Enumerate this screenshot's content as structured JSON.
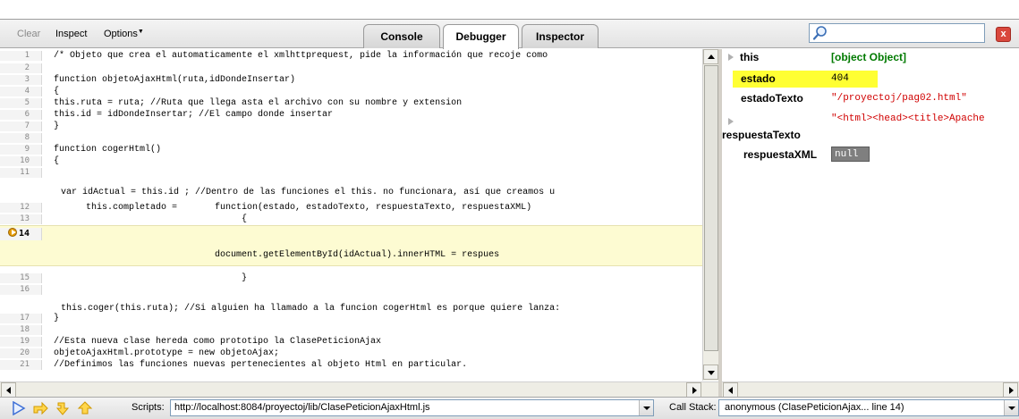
{
  "toolbar": {
    "clear_label": "Clear",
    "inspect_label": "Inspect",
    "options_label": "Options",
    "tabs": [
      {
        "label": "Console"
      },
      {
        "label": "Debugger"
      },
      {
        "label": "Inspector"
      }
    ],
    "search_placeholder": "",
    "close_label": "x"
  },
  "code": {
    "lines": [
      {
        "num": "1",
        "text": "/* Objeto que crea el automaticamente el xmlhttprequest, pide la información que recoje como "
      },
      {
        "num": "2",
        "text": ""
      },
      {
        "num": "3",
        "text": "function objetoAjaxHtml(ruta,idDondeInsertar)"
      },
      {
        "num": "4",
        "text": "{"
      },
      {
        "num": "5",
        "text": "this.ruta = ruta; //Ruta que llega asta el archivo con su nombre y extension"
      },
      {
        "num": "6",
        "text": "this.id = idDondeInsertar; //El campo donde insertar"
      },
      {
        "num": "7",
        "text": "}"
      },
      {
        "num": "8",
        "text": ""
      },
      {
        "num": "9",
        "text": "function cogerHtml()"
      },
      {
        "num": "10",
        "text": "{"
      },
      {
        "num": "11",
        "text": ""
      },
      {
        "num": "",
        "text": " var idActual = this.id ; //Dentro de las funciones el this. no funcionara, así que creamos u"
      },
      {
        "num": "12",
        "text": "      this.completado =       function(estado, estadoTexto, respuestaTexto, respuestaXML)"
      },
      {
        "num": "13",
        "text": "                                   {"
      },
      {
        "num": "14",
        "text": ""
      },
      {
        "num": "",
        "text": "                              document.getElementById(idActual).innerHTML = respues"
      },
      {
        "num": "15",
        "text": "                                   }"
      },
      {
        "num": "16",
        "text": ""
      },
      {
        "num": "",
        "text": " this.coger(this.ruta); //Si alguien ha llamado a la funcion cogerHtml es porque quiere lanza:"
      },
      {
        "num": "17",
        "text": "}"
      },
      {
        "num": "18",
        "text": ""
      },
      {
        "num": "19",
        "text": "//Esta nueva clase hereda como prototipo la ClasePeticionAjax"
      },
      {
        "num": "20",
        "text": "objetoAjaxHtml.prototype = new objetoAjax;"
      },
      {
        "num": "21",
        "text": "//Definimos las funciones nuevas pertenecientes al objeto Html en particular."
      }
    ]
  },
  "watch": {
    "this_name": "this",
    "this_value": "[object Object]",
    "estado_name": "estado",
    "estado_value": "404",
    "estadoTexto_name": "estadoTexto",
    "estadoTexto_value": "\"/proyectoj/pag02.html\"",
    "respuestaTexto_value": "\"<html><head><title>Apache",
    "respuestaTexto_name": "respuestaTexto",
    "respuestaXML_name": "respuestaXML",
    "respuestaXML_value": "null"
  },
  "statusbar": {
    "scripts_label": "Scripts:",
    "scripts_value": "http://localhost:8084/proyectoj/lib/ClasePeticionAjaxHtml.js",
    "callstack_label": "Call Stack:",
    "callstack_value": "anonymous (ClasePeticionAjax... line 14)"
  },
  "colors": {
    "current_line": "#fdfbd2",
    "highlight_watch": "#ffff33",
    "object_value": "#007a00",
    "string_value": "#d00000"
  }
}
